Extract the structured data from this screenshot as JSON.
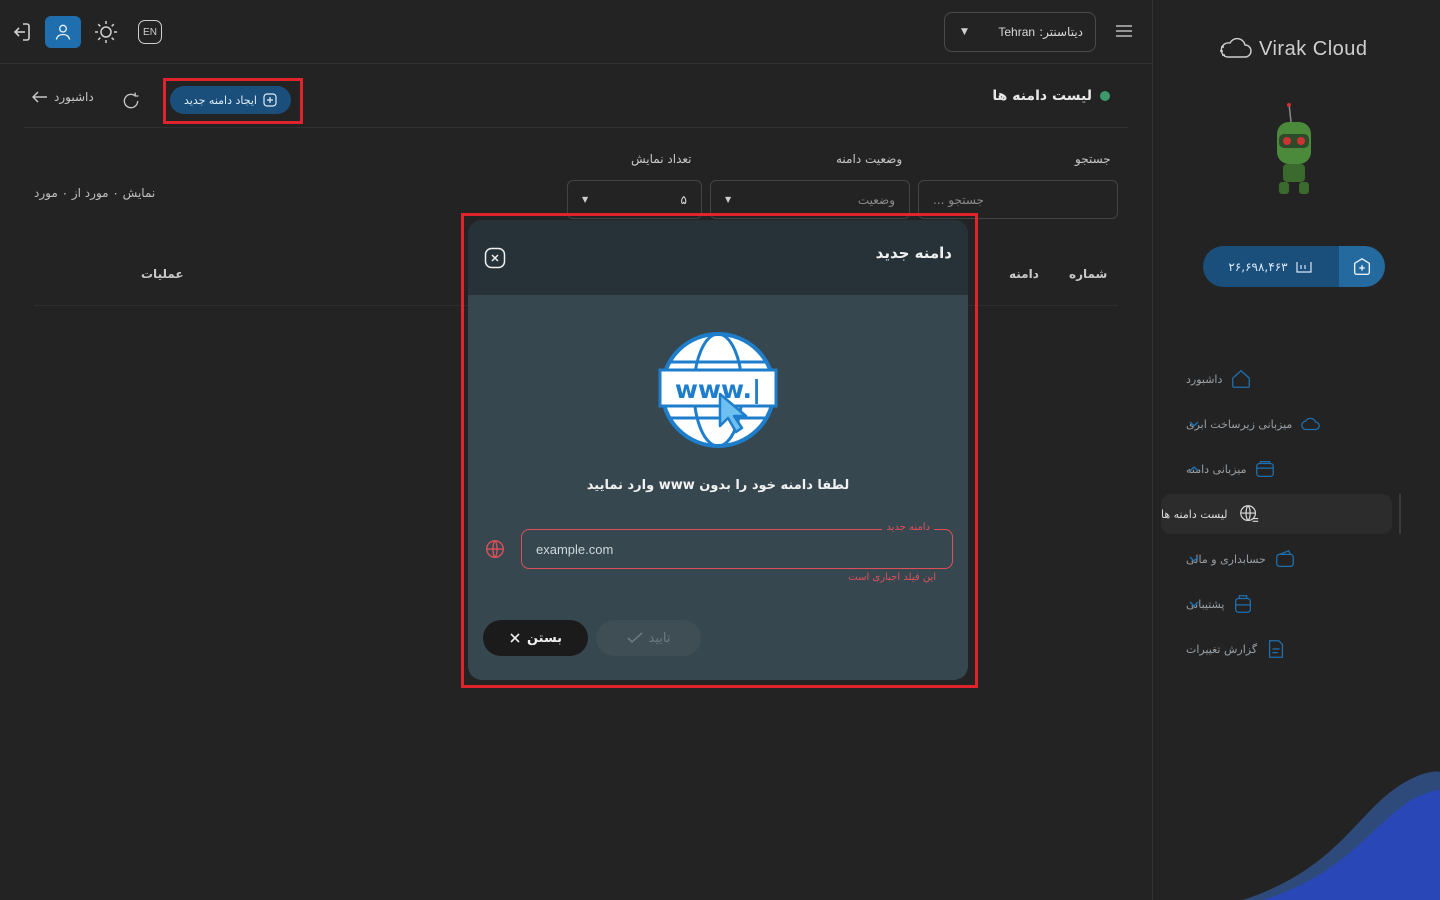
{
  "topbar": {
    "lang_label": "EN",
    "datacenter_label": "دیتاسنتر:",
    "datacenter_value": "Tehran"
  },
  "sidebar": {
    "brand": "Virak Cloud",
    "balance": "۲۶,۶۹۸,۴۶۳",
    "items": [
      {
        "label": "داشبورد",
        "icon": "home-icon",
        "expandable": false
      },
      {
        "label": "میزبانی زیرساخت ابری",
        "icon": "cloud-icon",
        "expandable": true
      },
      {
        "label": "میزبانی دامنه",
        "icon": "server-icon",
        "expandable": true,
        "expanded": true
      },
      {
        "label": "لیست دامنه ها",
        "icon": "globe-list-icon",
        "active": true
      },
      {
        "label": "حسابداری و مالی",
        "icon": "wallet-icon",
        "expandable": true
      },
      {
        "label": "پشتیبانی",
        "icon": "support-icon",
        "expandable": true
      },
      {
        "label": "گزارش تغییرات",
        "icon": "changelog-icon",
        "expandable": false
      }
    ]
  },
  "page": {
    "title": "لیست دامنه ها",
    "dashboard_link": "داشبورد",
    "new_domain_button": "ایجاد دامنه جدید"
  },
  "filters": {
    "search_label": "جستجو",
    "search_placeholder": "جستجو ...",
    "status_label": "وضعیت دامنه",
    "status_placeholder": "وضعیت",
    "count_label": "تعداد نمایش",
    "count_value": "۵",
    "showing_text": "نمایش ۰ مورد از ۰ مورد"
  },
  "table": {
    "columns": [
      "شماره",
      "دامنه",
      "عملیات"
    ]
  },
  "modal": {
    "title": "دامنه جدید",
    "instruction": "لطفا دامنه خود را بدون www وارد نمایید",
    "www_icon_text": "www.|",
    "field_legend": "دامنه جدید",
    "field_placeholder": "example.com",
    "field_error": "این فیلد اجباری است",
    "confirm_label": "تایید",
    "close_label": "بستن"
  },
  "colors": {
    "accent": "#1a4f7c",
    "highlight": "#e0242e",
    "error": "#e0505a",
    "status_dot": "#3d9a6c"
  }
}
